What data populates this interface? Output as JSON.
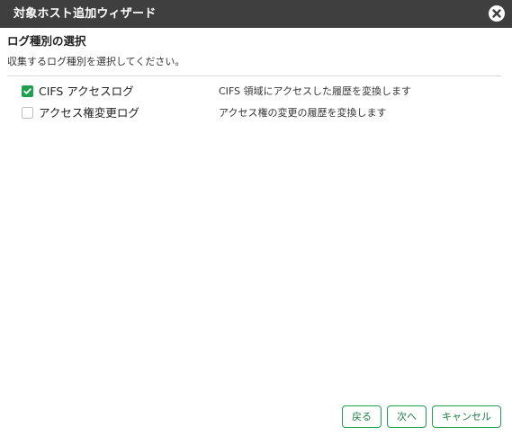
{
  "window": {
    "title": "対象ホスト追加ウィザード",
    "close_icon": "close-icon"
  },
  "step": {
    "title": "ログ種別の選択",
    "description": "収集するログ種別を選択してください。"
  },
  "log_types": [
    {
      "label": "CIFS アクセスログ",
      "description": "CIFS 領域にアクセスした履歴を変換します",
      "checked": true
    },
    {
      "label": "アクセス権変更ログ",
      "description": "アクセス権の変更の履歴を変換します",
      "checked": false
    }
  ],
  "buttons": {
    "back": "戻る",
    "next": "次へ",
    "cancel": "キャンセル"
  },
  "colors": {
    "titlebar": "#3f3f3f",
    "accent": "#1e9e4f"
  }
}
